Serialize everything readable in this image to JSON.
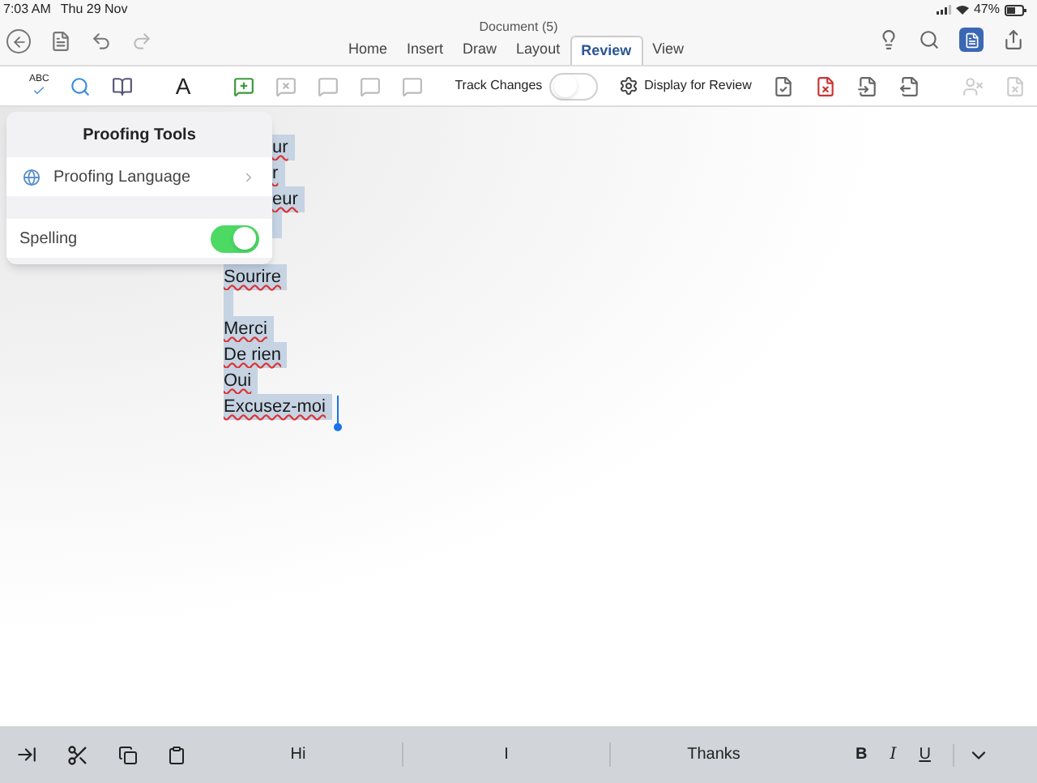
{
  "status_bar": {
    "time": "7:03 AM",
    "date": "Thu 29 Nov",
    "battery": "47%"
  },
  "window": {
    "title": "Document (5)"
  },
  "tabs": [
    {
      "label": "Home",
      "selected": false
    },
    {
      "label": "Insert",
      "selected": false
    },
    {
      "label": "Draw",
      "selected": false
    },
    {
      "label": "Layout",
      "selected": false
    },
    {
      "label": "Review",
      "selected": true
    },
    {
      "label": "View",
      "selected": false
    }
  ],
  "ribbon": {
    "spelling_icon_label": "ABC",
    "read_aloud_icon_label": "A",
    "track_changes": {
      "label": "Track Changes",
      "on": false
    },
    "display_for_review": "Display for Review"
  },
  "popover": {
    "title": "Proofing Tools",
    "language_item": "Proofing Language",
    "spelling": {
      "label": "Spelling",
      "on": true
    }
  },
  "document": {
    "partly_hidden_lines": [
      {
        "kind": "text",
        "text": "ur"
      },
      {
        "kind": "text",
        "text": "r"
      },
      {
        "kind": "text",
        "text": "eur"
      },
      {
        "kind": "blank"
      }
    ],
    "lines": [
      {
        "kind": "blank"
      },
      {
        "kind": "text",
        "text": "Sourire"
      },
      {
        "kind": "blank"
      },
      {
        "kind": "text",
        "text": "Merci"
      },
      {
        "kind": "text",
        "text": "De rien"
      },
      {
        "kind": "text",
        "text": "Oui"
      },
      {
        "kind": "text",
        "text": "Excusez-moi"
      }
    ]
  },
  "keyboard_bar": {
    "suggestions": [
      "Hi",
      "I",
      "Thanks"
    ],
    "format": [
      "B",
      "I",
      "U"
    ]
  }
}
